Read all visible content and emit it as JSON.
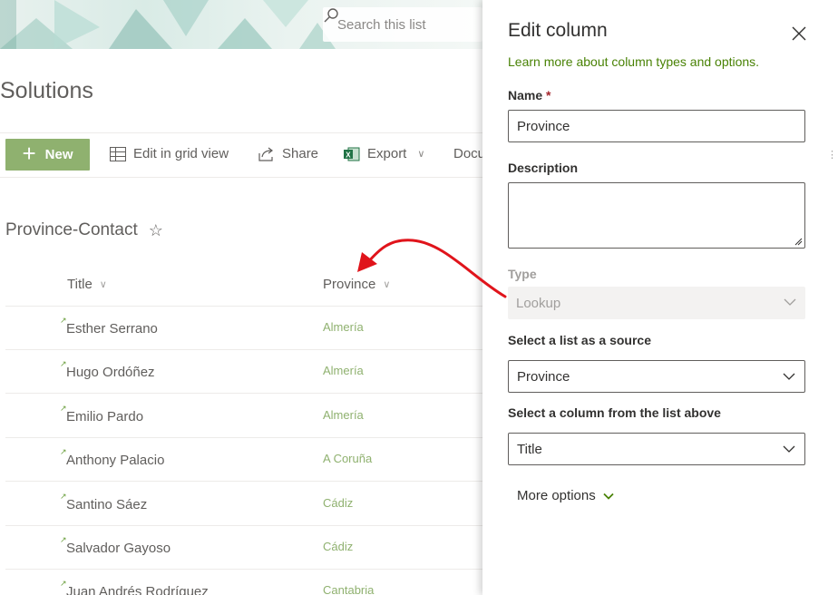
{
  "banner": {
    "search_placeholder": "Search this list"
  },
  "site": {
    "title": "Solutions"
  },
  "commandbar": {
    "new_label": "New",
    "edit_grid_label": "Edit in grid view",
    "share_label": "Share",
    "export_label": "Export",
    "docu_label": "Docu"
  },
  "view": {
    "title": "Province-Contact",
    "columns": {
      "title": "Title",
      "province": "Province"
    },
    "rows": [
      {
        "title": "Esther Serrano",
        "province": "Almería"
      },
      {
        "title": "Hugo Ordóñez",
        "province": "Almería"
      },
      {
        "title": "Emilio Pardo",
        "province": "Almería"
      },
      {
        "title": "Anthony Palacio",
        "province": "A Coruña"
      },
      {
        "title": "Santino Sáez",
        "province": "Cádiz"
      },
      {
        "title": "Salvador Gayoso",
        "province": "Cádiz"
      },
      {
        "title": "Juan Andrés Rodríguez",
        "province": "Cantabria"
      }
    ]
  },
  "panel": {
    "title": "Edit column",
    "learn_link": "Learn more about column types and options.",
    "name_label": "Name",
    "required_mark": "*",
    "name_value": "Province",
    "description_label": "Description",
    "description_value": "",
    "type_label": "Type",
    "type_value": "Lookup",
    "source_list_label": "Select a list as a source",
    "source_list_value": "Province",
    "source_column_label": "Select a column from the list above",
    "source_column_value": "Title",
    "more_options_label": "More options"
  },
  "colors": {
    "accent_green": "#8fb16f",
    "link_green": "#498205",
    "annotation_red": "#e0141b"
  }
}
